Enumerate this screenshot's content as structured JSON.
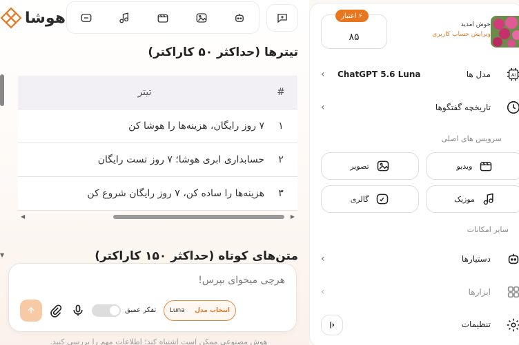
{
  "brand": {
    "name": "هوشا",
    "accent": "#e8761f"
  },
  "toolbar": {
    "icons": [
      "chat-bubble-icon",
      "music-icon",
      "video-icon",
      "image-icon",
      "robot-icon"
    ],
    "new_chat_icon": "new-chat-icon"
  },
  "main": {
    "titles_heading": "تیترها (حداکثر ۵۰ کاراکتر)",
    "table": {
      "headers": {
        "num": "#",
        "title": "تیتر"
      },
      "rows": [
        {
          "num": "۱",
          "title": "۷ روز رایگان، هزینه‌ها را هوشا کن"
        },
        {
          "num": "۲",
          "title": "حسابداری ابری هوشا؛ ۷ روز تست رایگان"
        },
        {
          "num": "۳",
          "title": "هزینه‌ها را ساده کن، ۷ روز رایگان شروع کن"
        }
      ]
    },
    "short_heading": "متن‌های کوتاه (حداکثر ۱۵۰ کاراکتر)"
  },
  "composer": {
    "placeholder": "هرچی میخوای بپرس!",
    "deep_think_label": "تفکر عمیق",
    "model_select_label": "انتخاب مدل",
    "model_name": "Luna",
    "send_icon": "arrow-up-icon"
  },
  "disclaimer": "هوش مصنوعی ممکن است اشتباه کند؛ اطلاعات مهم را بررسی کنید.",
  "sidebar": {
    "credit_label": "اعتبار",
    "credit_value": "۸۵",
    "welcome": "خوش امدید",
    "edit_account": "ویرایش حساب کاربری",
    "models_label": "مدل ها",
    "model_value": "ChatGPT 5.6 Luna",
    "history_label": "تاریخچه گفتگوها",
    "main_services_label": "سرویس های اصلی",
    "services": {
      "video": "ویدیو",
      "image": "تصویر",
      "music": "موزیک",
      "gallery": "گالری"
    },
    "other_features_label": "سایر امکانات",
    "assistants_label": "دستیارها",
    "tools_label": "ابزارها",
    "settings_label": "تنظیمات"
  }
}
